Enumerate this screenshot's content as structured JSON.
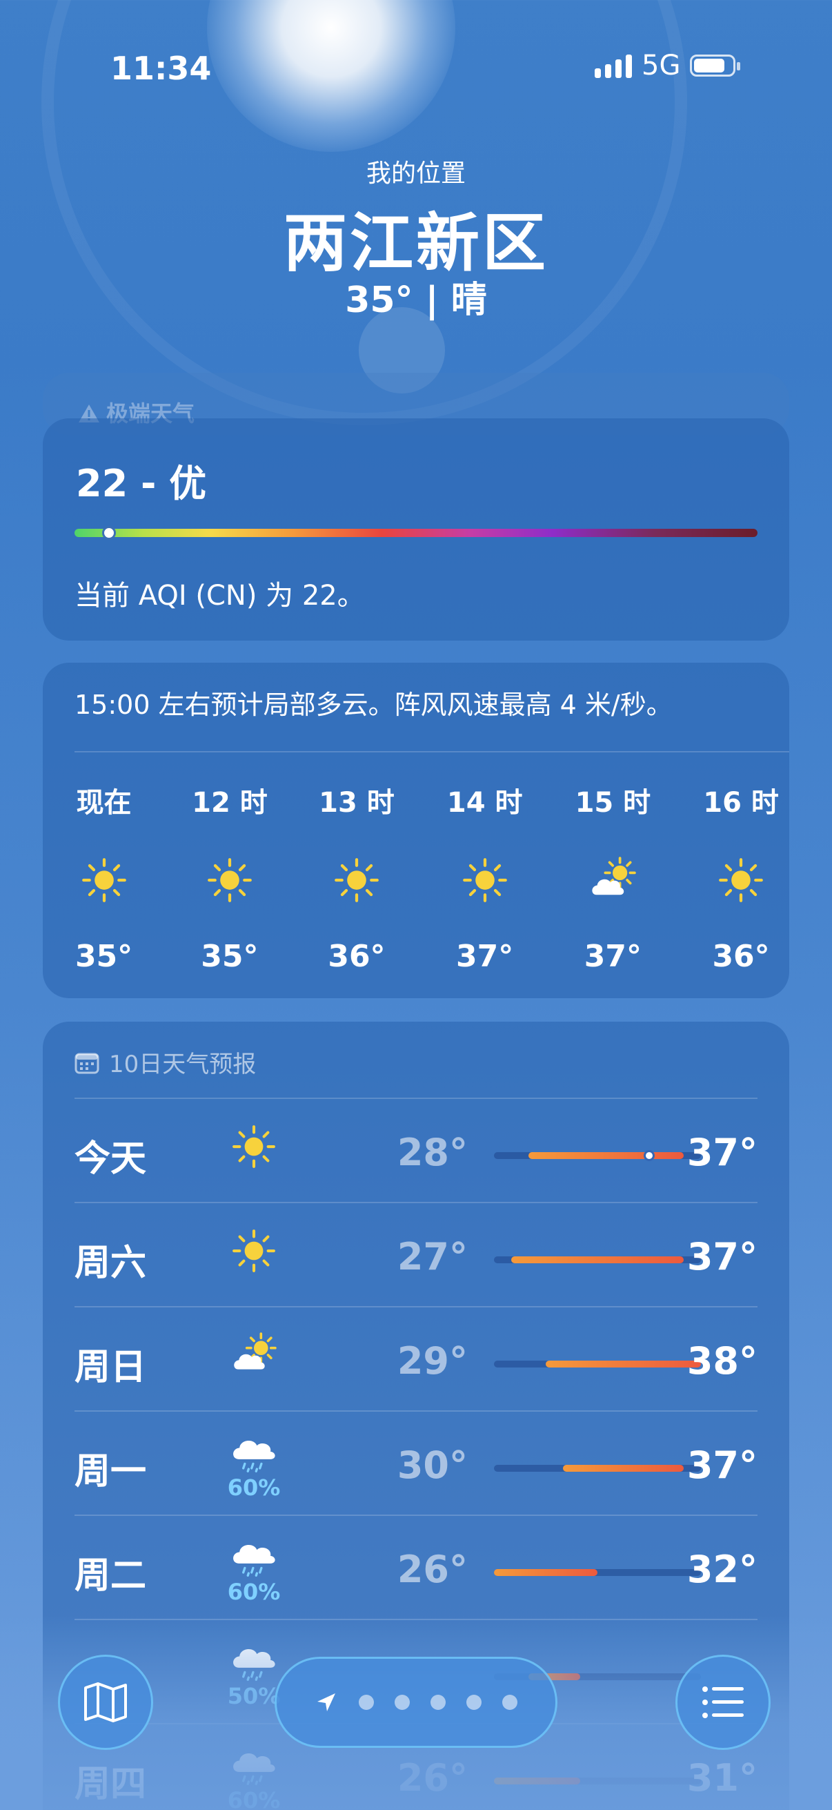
{
  "status_bar": {
    "time": "11:34",
    "network": "5G"
  },
  "location": {
    "label": "我的位置",
    "name": "两江新区",
    "summary": "35° | 晴"
  },
  "extreme_weather": {
    "title": "极端天气"
  },
  "aqi": {
    "value_label": "22 - 优",
    "level_fraction": 0.05,
    "description": "当前 AQI (CN) 为 22。"
  },
  "hourly": {
    "summary": "15:00 左右预计局部多云。阵风风速最高 4 米/秒。",
    "items": [
      {
        "label": "现在",
        "icon": "sun-icon",
        "temp": "35°"
      },
      {
        "label": "12 时",
        "icon": "sun-icon",
        "temp": "35°"
      },
      {
        "label": "13 时",
        "icon": "sun-icon",
        "temp": "36°"
      },
      {
        "label": "14 时",
        "icon": "sun-icon",
        "temp": "37°"
      },
      {
        "label": "15 时",
        "icon": "partly-cloudy-icon",
        "temp": "37°"
      },
      {
        "label": "16 时",
        "icon": "sun-icon",
        "temp": "36°"
      }
    ]
  },
  "forecast": {
    "title": "10日天气预报",
    "range_min": 26,
    "range_max": 38,
    "days": [
      {
        "day": "今天",
        "icon": "sun-icon",
        "precip": "",
        "low": "28°",
        "high": "37°",
        "low_val": 28,
        "high_val": 37,
        "current_val": 35
      },
      {
        "day": "周六",
        "icon": "sun-icon",
        "precip": "",
        "low": "27°",
        "high": "37°",
        "low_val": 27,
        "high_val": 37
      },
      {
        "day": "周日",
        "icon": "partly-cloudy-icon",
        "precip": "",
        "low": "29°",
        "high": "38°",
        "low_val": 29,
        "high_val": 38
      },
      {
        "day": "周一",
        "icon": "rain-cloud-icon",
        "precip": "60%",
        "low": "30°",
        "high": "37°",
        "low_val": 30,
        "high_val": 37
      },
      {
        "day": "周二",
        "icon": "rain-cloud-icon",
        "precip": "60%",
        "low": "26°",
        "high": "32°",
        "low_val": 26,
        "high_val": 32
      },
      {
        "day": "",
        "icon": "rain-cloud-icon",
        "precip": "50%",
        "low": "",
        "high": "",
        "low_val": 28,
        "high_val": 31
      },
      {
        "day": "周四",
        "icon": "rain-cloud-icon",
        "precip": "60%",
        "low": "26°",
        "high": "31°",
        "low_val": 26,
        "high_val": 31
      }
    ]
  },
  "toolbar": {
    "map": "map-icon",
    "location": "location-arrow-icon",
    "list": "list-icon",
    "page_count": 5
  },
  "colors": {
    "accent_orange": "#f59a3b",
    "accent_red": "#ec5a3e",
    "precip_blue": "#7fd0ff",
    "sun_yellow": "#f7d23c"
  }
}
